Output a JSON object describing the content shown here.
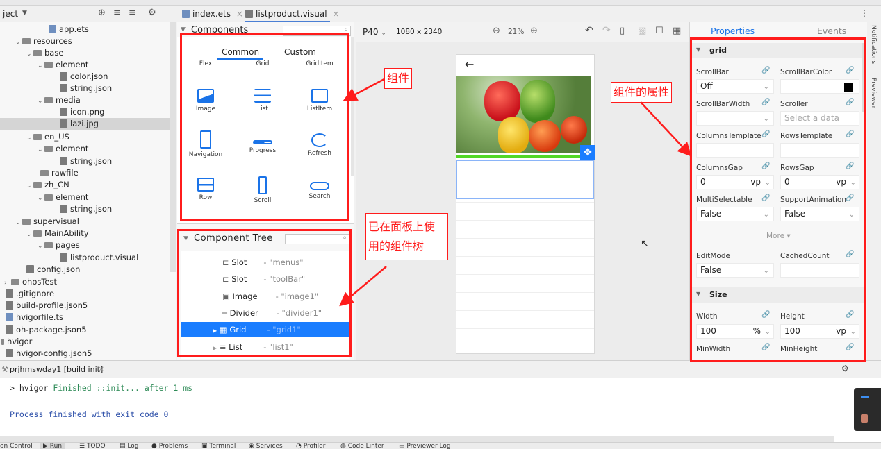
{
  "editor_tabs": [
    {
      "label": "index.ets"
    },
    {
      "label": "listproduct.visual"
    }
  ],
  "project_tree": {
    "header": "ject",
    "items": [
      {
        "label": "app.ets"
      },
      {
        "label": "resources"
      },
      {
        "label": "base"
      },
      {
        "label": "element"
      },
      {
        "label": "color.json"
      },
      {
        "label": "string.json"
      },
      {
        "label": "media"
      },
      {
        "label": "icon.png"
      },
      {
        "label": "lazi.jpg"
      },
      {
        "label": "en_US"
      },
      {
        "label": "element"
      },
      {
        "label": "string.json"
      },
      {
        "label": "rawfile"
      },
      {
        "label": "zh_CN"
      },
      {
        "label": "element"
      },
      {
        "label": "string.json"
      },
      {
        "label": "supervisual"
      },
      {
        "label": "MainAbility"
      },
      {
        "label": "pages"
      },
      {
        "label": "listproduct.visual"
      },
      {
        "label": "config.json"
      },
      {
        "label": "ohosTest"
      },
      {
        "label": ".gitignore"
      },
      {
        "label": "build-profile.json5"
      },
      {
        "label": "hvigorfile.ts"
      },
      {
        "label": "oh-package.json5"
      },
      {
        "label": "hvigor"
      },
      {
        "label": "hvigor-config.json5"
      }
    ]
  },
  "components_panel": {
    "title": "Components",
    "tabs": [
      "Common",
      "Custom"
    ],
    "items": [
      {
        "label": "Flex"
      },
      {
        "label": "Grid"
      },
      {
        "label": "GridItem"
      },
      {
        "label": "Image"
      },
      {
        "label": "List"
      },
      {
        "label": "ListItem"
      },
      {
        "label": "Navigation"
      },
      {
        "label": "Progress"
      },
      {
        "label": "Refresh"
      },
      {
        "label": "Row"
      },
      {
        "label": "Scroll"
      },
      {
        "label": "Search"
      }
    ]
  },
  "component_tree": {
    "title": "Component Tree",
    "rows": [
      {
        "type": "Slot",
        "id": "- \"menus\""
      },
      {
        "type": "Slot",
        "id": "- \"toolBar\""
      },
      {
        "type": "Image",
        "id": "- \"image1\""
      },
      {
        "type": "Divider",
        "id": "- \"divider1\""
      },
      {
        "type": "Grid",
        "id": "- \"grid1\""
      },
      {
        "type": "List",
        "id": "- \"list1\""
      }
    ]
  },
  "canvas": {
    "device": "P40",
    "resolution": "1080 x 2340",
    "zoom": "21%"
  },
  "properties": {
    "tabs": [
      "Properties",
      "Events"
    ],
    "section1": "grid",
    "fields": [
      {
        "label": "ScrollBar",
        "value": "Off"
      },
      {
        "label": "ScrollBarColor",
        "value": ""
      },
      {
        "label": "ScrollBarWidth",
        "value": ""
      },
      {
        "label": "Scroller",
        "value": "Select a data"
      },
      {
        "label": "ColumnsTemplate",
        "value": ""
      },
      {
        "label": "RowsTemplate",
        "value": ""
      },
      {
        "label": "ColumnsGap",
        "value": "0",
        "unit": "vp"
      },
      {
        "label": "RowsGap",
        "value": "0",
        "unit": "vp"
      },
      {
        "label": "MultiSelectable",
        "value": "False"
      },
      {
        "label": "SupportAnimation",
        "value": "False"
      }
    ],
    "more": "More",
    "fields2": [
      {
        "label": "EditMode",
        "value": "False"
      },
      {
        "label": "CachedCount",
        "value": ""
      }
    ],
    "section2": "Size",
    "size_fields": [
      {
        "label": "Width",
        "value": "100",
        "unit": "%"
      },
      {
        "label": "Height",
        "value": "100",
        "unit": "vp"
      },
      {
        "label": "MinWidth",
        "value": ""
      },
      {
        "label": "MinHeight",
        "value": ""
      }
    ],
    "scrollbar_color_hex": "#000000"
  },
  "notifications": {
    "label1": "Notifications",
    "label2": "Previewer"
  },
  "run_panel": {
    "tab": "prjhmswday1 [build init]",
    "lines": [
      {
        "prompt": "> hvigor",
        "text": " Finished ::init... after 1 ms"
      },
      {
        "prompt": "",
        "text": "Process finished with exit code 0"
      }
    ]
  },
  "status_bar": {
    "items": [
      "on Control",
      "Run",
      "TODO",
      "Log",
      "Problems",
      "Terminal",
      "Services",
      "Profiler",
      "Code Linter",
      "Previewer Log"
    ]
  },
  "annotations": [
    {
      "text": "组件"
    },
    {
      "text": "组件的属性"
    },
    {
      "text": "已在面板上使用的组件树"
    }
  ],
  "colors": {
    "annotation_red": "#ff1c1c",
    "selection_blue": "#1a7dff",
    "accent": "#1a73e8",
    "progress_green": "#52d726"
  }
}
